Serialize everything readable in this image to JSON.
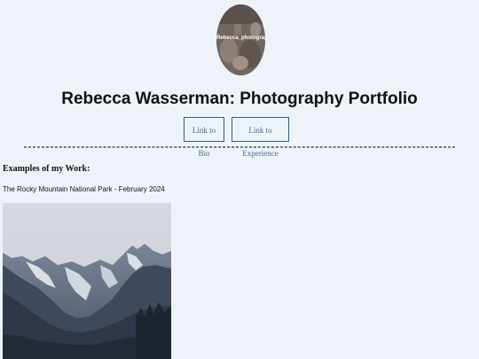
{
  "header": {
    "logo_text": "Rebecca_photography",
    "title": "Rebecca Wasserman: Photography Portfolio"
  },
  "nav": {
    "bio_label": "Link to Bio",
    "experience_label": "Link to Experience"
  },
  "main": {
    "section_heading": "Examples of my Work:",
    "photos": [
      {
        "caption": "The Rocky Mountain National Park - February 2024"
      }
    ]
  },
  "colors": {
    "page_background": "#eef3fa",
    "button_border": "#2f5d8a",
    "button_text": "#4a6a8f"
  }
}
